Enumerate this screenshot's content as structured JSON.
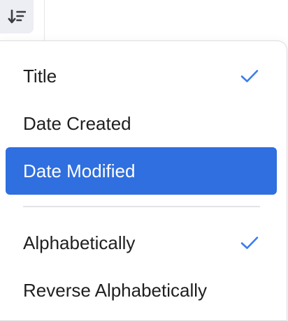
{
  "toolbar": {
    "sort_button_icon": "sort-descending-icon"
  },
  "menu": {
    "sort_by_items": [
      {
        "label": "Title",
        "checked": true,
        "selected": false
      },
      {
        "label": "Date Created",
        "checked": false,
        "selected": false
      },
      {
        "label": "Date Modified",
        "checked": false,
        "selected": true
      }
    ],
    "order_items": [
      {
        "label": "Alphabetically",
        "checked": true,
        "selected": false
      },
      {
        "label": "Reverse Alphabetically",
        "checked": false,
        "selected": false
      }
    ]
  },
  "colors": {
    "accent": "#2f6fdf",
    "check": "#3b7cf0",
    "text": "#1f1f1f",
    "button_bg": "#eceef3"
  }
}
